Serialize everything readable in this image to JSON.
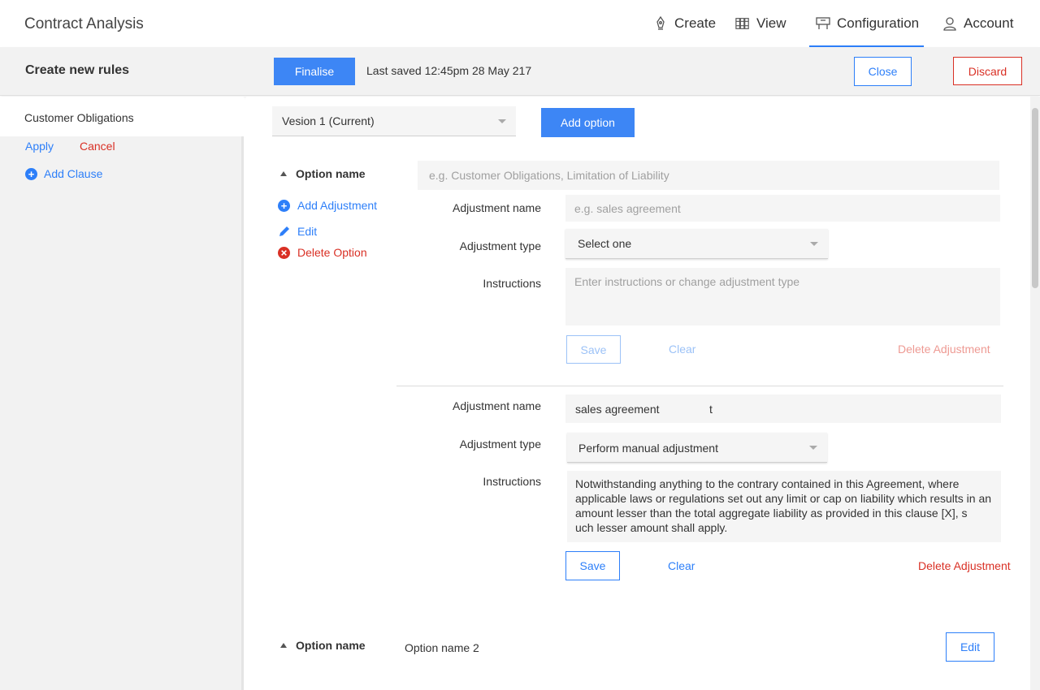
{
  "app": {
    "title": "Contract Analysis"
  },
  "nav": {
    "create": "Create",
    "view": "View",
    "configuration": "Configuration",
    "account": "Account"
  },
  "header": {
    "title": "Create new rules",
    "finalise": "Finalise",
    "last_saved": "Last saved 12:45pm 28 May 217",
    "close": "Close",
    "discard": "Discard"
  },
  "sidebar": {
    "clause_name": "Customer Obligations",
    "apply": "Apply",
    "cancel": "Cancel",
    "add_clause": "Add Clause"
  },
  "main": {
    "version_select": "Vesion 1 (Current)",
    "add_option": "Add option",
    "option1": {
      "label": "Option name",
      "placeholder": "e.g. Customer Obligations, Limitation of Liability",
      "add_adjustment": "Add Adjustment",
      "edit": "Edit",
      "delete_option": "Delete Option",
      "adjustment1": {
        "name_label": "Adjustment name",
        "name_placeholder": "e.g. sales agreement",
        "type_label": "Adjustment type",
        "type_value": "Select one",
        "instructions_label": "Instructions",
        "instructions_placeholder": "Enter instructions or change adjustment type",
        "save": "Save",
        "clear": "Clear",
        "delete": "Delete Adjustment"
      },
      "adjustment2": {
        "name_label": "Adjustment name",
        "name_value": "sales agreement",
        "name_extra": "t",
        "type_label": "Adjustment type",
        "type_value": "Perform manual adjustment",
        "instructions_label": "Instructions",
        "instructions_lines": [
          "Notwithstanding anything to the contrary contained in this Agreement, where",
          "applicable laws or regulations set out any limit or cap on liability which results in an",
          "amount lesser than the total aggregate liability as provided in this clause [X], s",
          "uch lesser amount shall apply."
        ],
        "save": "Save",
        "clear": "Clear",
        "delete": "Delete Adjustment"
      }
    },
    "option2": {
      "label": "Option name",
      "value": "Option name 2",
      "edit": "Edit"
    }
  },
  "colors": {
    "accent": "#2d7ff9",
    "danger": "#d93025",
    "sidebar_bg": "#f2f2f2"
  }
}
